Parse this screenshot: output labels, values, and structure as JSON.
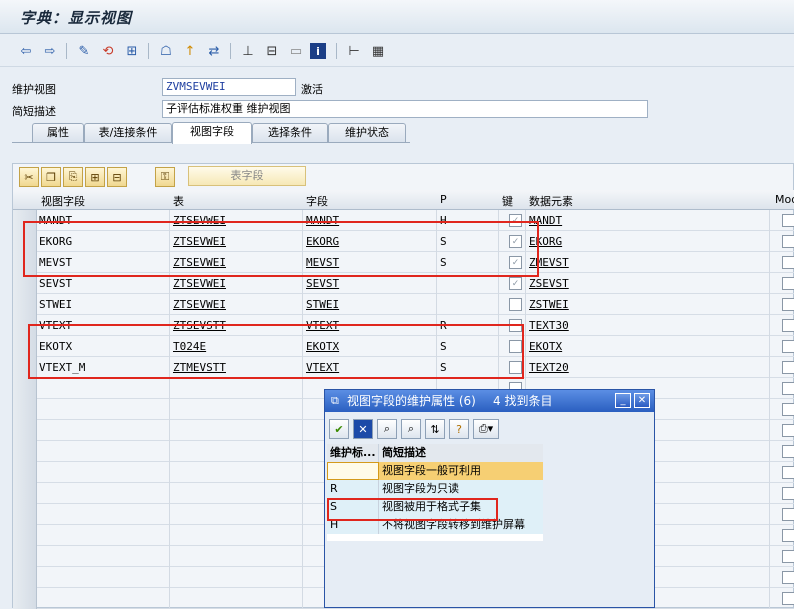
{
  "window": {
    "title": "字典：显示视图"
  },
  "header": {
    "view_label": "维护视图",
    "view_value": "ZVMSEVWEI",
    "view_status": "激活",
    "desc_label": "简短描述",
    "desc_value": "子评估标准权重 维护视图"
  },
  "tabs": [
    {
      "label": "属性"
    },
    {
      "label": "表/连接条件"
    },
    {
      "label": "视图字段"
    },
    {
      "label": "选择条件"
    },
    {
      "label": "维护状态"
    }
  ],
  "grid": {
    "table_field_button": "表字段",
    "columns": [
      "视图字段",
      "表",
      "字段",
      "P",
      "键",
      "数据元素",
      "Mod"
    ],
    "rows": [
      {
        "viewfield": "MANDT",
        "table": "ZTSEVWEI",
        "field": "MANDT",
        "p": "H",
        "key": true,
        "element": "MANDT"
      },
      {
        "viewfield": "EKORG",
        "table": "ZTSEVWEI",
        "field": "EKORG",
        "p": "S",
        "key": true,
        "element": "EKORG"
      },
      {
        "viewfield": "MEVST",
        "table": "ZTSEVWEI",
        "field": "MEVST",
        "p": "S",
        "key": true,
        "element": "ZMEVST"
      },
      {
        "viewfield": "SEVST",
        "table": "ZTSEVWEI",
        "field": "SEVST",
        "p": "",
        "key": true,
        "element": "ZSEVST"
      },
      {
        "viewfield": "STWEI",
        "table": "ZTSEVWEI",
        "field": "STWEI",
        "p": "",
        "key": false,
        "element": "ZSTWEI"
      },
      {
        "viewfield": "VTEXT",
        "table": "ZTSEVSTT",
        "field": "VTEXT",
        "p": "R",
        "key": false,
        "element": "TEXT30"
      },
      {
        "viewfield": "EKOTX",
        "table": "T024E",
        "field": "EKOTX",
        "p": "S",
        "key": false,
        "element": "EKOTX"
      },
      {
        "viewfield": "VTEXT_M",
        "table": "ZTMEVSTT",
        "field": "VTEXT",
        "p": "S",
        "key": false,
        "element": "TEXT20"
      }
    ]
  },
  "popup": {
    "title": "视图字段的维护属性 (6)",
    "found": "4 找到条目",
    "columns": [
      "维护标...",
      "简短描述"
    ],
    "rows": [
      {
        "key": "",
        "desc": "视图字段一般可利用"
      },
      {
        "key": "R",
        "desc": "视图字段为只读"
      },
      {
        "key": "S",
        "desc": "视图被用于格式子集"
      },
      {
        "key": "H",
        "desc": "不将视图字段转移到维护屏幕"
      }
    ]
  },
  "colors": {
    "highlight": "#e0261d",
    "popup_header": "#2a5fc0",
    "link_blue": "#1f3fa0"
  },
  "icons": [
    "back-icon",
    "forward-icon",
    "other-object-icon",
    "display-change-icon",
    "activate-icon",
    "where-used-icon",
    "navigate-icon",
    "hierarchy-icon",
    "print-icon",
    "info-icon",
    "layout-icon",
    "grid-icon"
  ]
}
